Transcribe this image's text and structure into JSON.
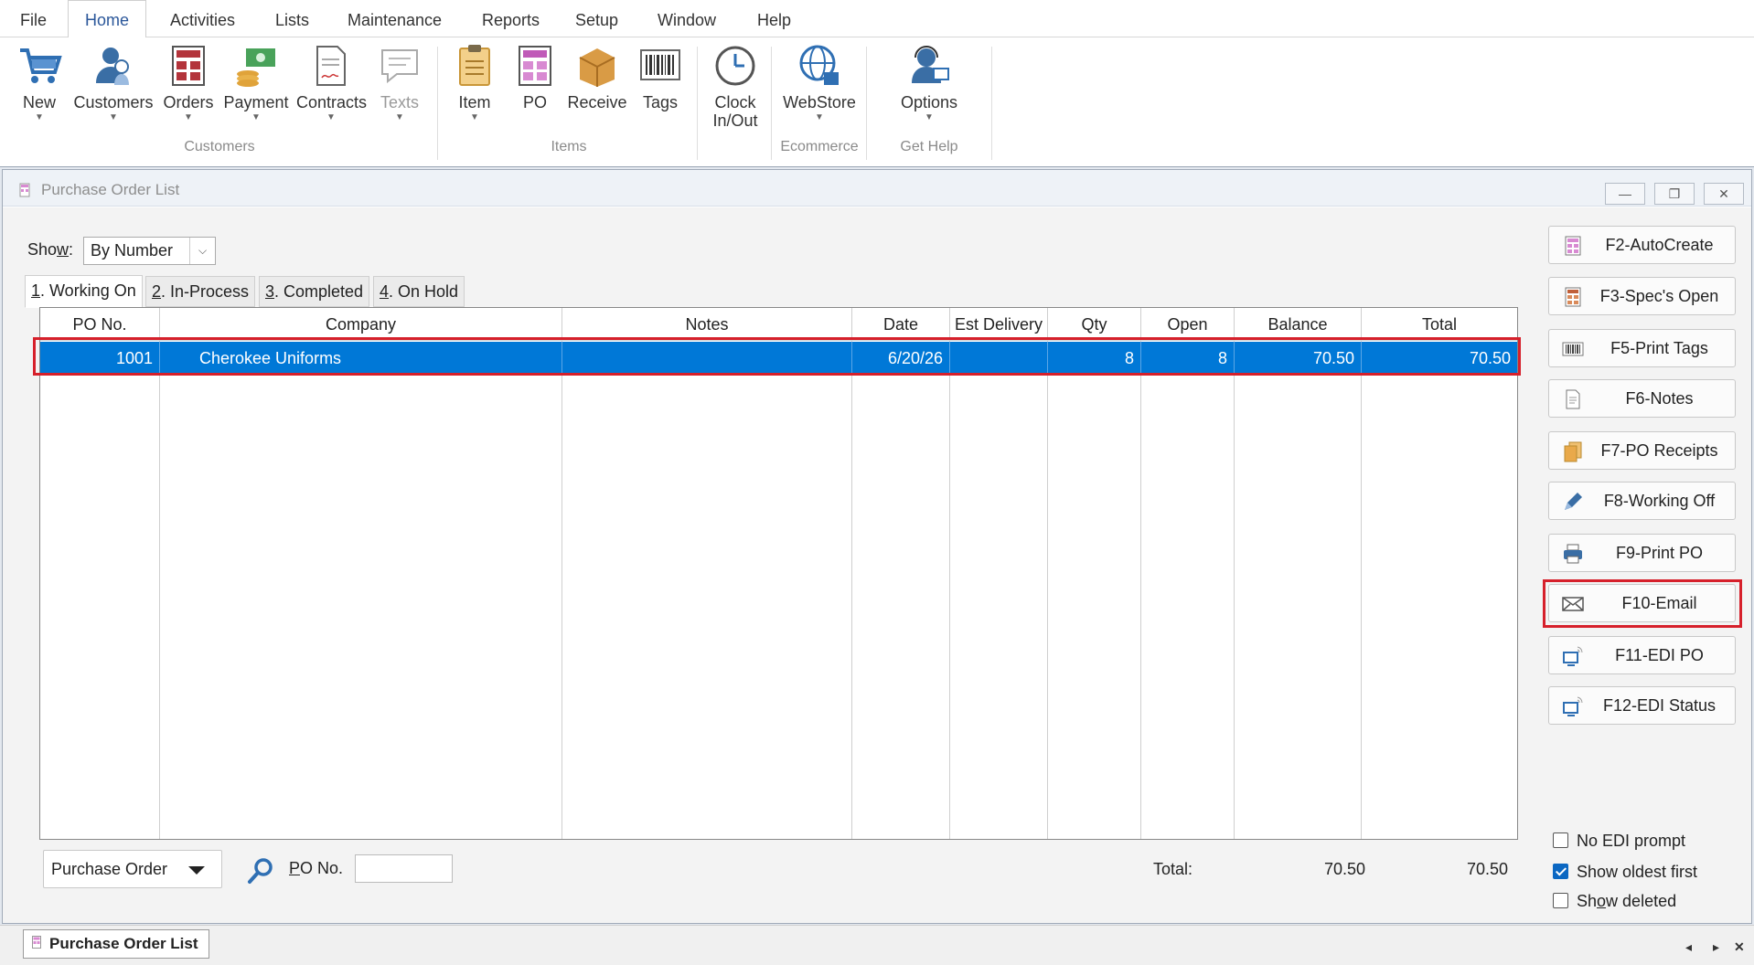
{
  "menu": {
    "items": [
      "File",
      "Home",
      "Activities",
      "Lists",
      "Maintenance",
      "Reports",
      "Setup",
      "Window",
      "Help"
    ],
    "active": "Home"
  },
  "ribbon": {
    "buttons": {
      "new": "New",
      "customers": "Customers",
      "orders": "Orders",
      "payment": "Payment",
      "contracts": "Contracts",
      "texts": "Texts",
      "item": "Item",
      "po": "PO",
      "receive": "Receive",
      "tags": "Tags",
      "clock_line1": "Clock",
      "clock_line2": "In/Out",
      "webstore": "WebStore",
      "options": "Options"
    },
    "groups": {
      "customers": "Customers",
      "items": "Items",
      "ecommerce": "Ecommerce",
      "help": "Get Help"
    }
  },
  "window": {
    "title": "Purchase Order List"
  },
  "show": {
    "label_pre": "Sho",
    "label_ul": "w",
    "label_post": ":",
    "value": "By Number"
  },
  "tabs": [
    {
      "num": "1",
      "label": ". Working On"
    },
    {
      "num": "2",
      "label": ". In-Process"
    },
    {
      "num": "3",
      "label": ". Completed"
    },
    {
      "num": "4",
      "label": ". On Hold"
    }
  ],
  "grid": {
    "columns": [
      "PO No.",
      "Company",
      "Notes",
      "Date",
      "Est Delivery",
      "Qty",
      "Open",
      "Balance",
      "Total"
    ],
    "rows": [
      {
        "po_no": "1001",
        "company": "Cherokee Uniforms",
        "notes": "",
        "date": "6/20/26",
        "est_delivery": "",
        "qty": "8",
        "open": "8",
        "balance": "70.50",
        "total": "70.50"
      }
    ]
  },
  "side_buttons": {
    "autocreate": "F2-AutoCreate",
    "specs_open": "F3-Spec's Open",
    "print_tags": "F5-Print Tags",
    "notes": "F6-Notes",
    "po_receipts": "F7-PO Receipts",
    "working_off": "F8-Working Off",
    "print_po": "F9-Print PO",
    "email": "F10-Email",
    "edi_po": "F11-EDI PO",
    "edi_status": "F12-EDI Status"
  },
  "bottom": {
    "type_select": "Purchase Order",
    "po_label_ul": "P",
    "po_label_rest": "O No.",
    "po_input": "",
    "total_label": "Total:",
    "total_balance": "70.50",
    "total_total": "70.50"
  },
  "options": {
    "no_edi_prompt": {
      "label": "No EDI prompt",
      "checked": false
    },
    "show_oldest_first": {
      "label": "Show oldest first",
      "checked": true
    },
    "show_deleted_pre": "Sh",
    "show_deleted_ul": "o",
    "show_deleted_post": "w deleted",
    "show_deleted_checked": false
  },
  "taskbar": {
    "window_tab": "Purchase Order List"
  },
  "colors": {
    "selection": "#0078d7",
    "highlight": "#d6202b",
    "accent": "#2b579a"
  }
}
